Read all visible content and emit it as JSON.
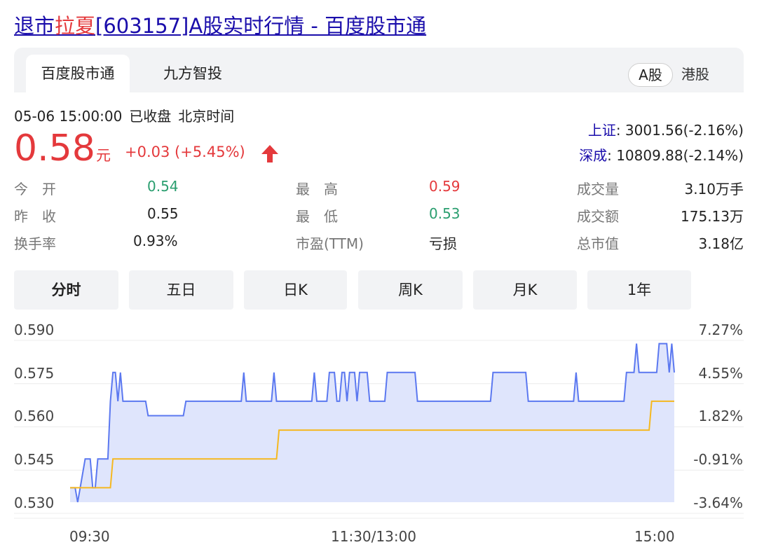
{
  "title": {
    "prefix": "退市",
    "highlight": "拉夏",
    "suffix": "[603157]A股实时行情 - 百度股市通"
  },
  "tabs": [
    "百度股市通",
    "九方智投"
  ],
  "market_toggle": {
    "a_share": "A股",
    "hk_share": "港股"
  },
  "status": {
    "datetime": "05-06 15:00:00",
    "state": "已收盘",
    "timezone": "北京时间"
  },
  "quote": {
    "price": "0.58",
    "unit": "元",
    "change": "+0.03 (+5.45%)",
    "direction": "up"
  },
  "indices": [
    {
      "name": "上证",
      "value": ": 3001.56(-2.16%)"
    },
    {
      "name": "深成",
      "value": ": 10809.88(-2.14%)"
    }
  ],
  "stats": {
    "open": {
      "label": "今　开",
      "value": "0.54"
    },
    "prev": {
      "label": "昨　收",
      "value": "0.55"
    },
    "turnover": {
      "label": "换手率",
      "value": "0.93%"
    },
    "high": {
      "label": "最　高",
      "value": "0.59"
    },
    "low": {
      "label": "最　低",
      "value": "0.53"
    },
    "pe": {
      "label": "市盈(TTM)",
      "value": "亏损"
    },
    "volume": {
      "label": "成交量",
      "value": "3.10万手"
    },
    "amount": {
      "label": "成交额",
      "value": "175.13万"
    },
    "mktcap": {
      "label": "总市值",
      "value": "3.18亿"
    }
  },
  "periods": [
    "分时",
    "五日",
    "日K",
    "周K",
    "月K",
    "1年"
  ],
  "colors": {
    "up": "#e4393c",
    "down": "#2a9e6f",
    "price_line": "#5b78f0",
    "avg_line": "#f5b820",
    "fill": "#dfe5fc"
  },
  "chart_data": {
    "type": "line",
    "y_left_ticks": [
      "0.590",
      "0.575",
      "0.560",
      "0.545",
      "0.530"
    ],
    "y_right_ticks": [
      "7.27%",
      "4.55%",
      "1.82%",
      "-0.91%",
      "-3.64%"
    ],
    "x_ticks": [
      "09:30",
      "11:30/13:00",
      "15:00"
    ],
    "ylim": [
      0.525,
      0.595
    ],
    "x_range": [
      0,
      240
    ],
    "grid": true,
    "series": [
      {
        "role": "price",
        "x": [
          0,
          2,
          3,
          4,
          6,
          8,
          9,
          10,
          11,
          15,
          16,
          17,
          18,
          19,
          20,
          21,
          22,
          23,
          24,
          28,
          29,
          30,
          31,
          32,
          33,
          34,
          44,
          45,
          46,
          54,
          55,
          56,
          68,
          69,
          70,
          71,
          72,
          80,
          81,
          82,
          83,
          96,
          97,
          98,
          99,
          102,
          103,
          104,
          105,
          106,
          107,
          108,
          109,
          110,
          111,
          112,
          113,
          114,
          115,
          116,
          117,
          118,
          119,
          125,
          126,
          127,
          128,
          135,
          136,
          137,
          138,
          140,
          141,
          142,
          143,
          144,
          165,
          166,
          167,
          168,
          169,
          174,
          175,
          176,
          177,
          178,
          180,
          181,
          182,
          183,
          200,
          201,
          202,
          203,
          220,
          221,
          222,
          223,
          224,
          225,
          226,
          233,
          234,
          235,
          236,
          237,
          238,
          239,
          240
        ],
        "values": [
          0.535,
          0.535,
          0.53,
          0.535,
          0.545,
          0.545,
          0.535,
          0.535,
          0.545,
          0.545,
          0.565,
          0.575,
          0.575,
          0.565,
          0.575,
          0.565,
          0.565,
          0.565,
          0.565,
          0.565,
          0.565,
          0.565,
          0.56,
          0.56,
          0.56,
          0.56,
          0.56,
          0.56,
          0.565,
          0.565,
          0.565,
          0.565,
          0.565,
          0.575,
          0.565,
          0.565,
          0.565,
          0.565,
          0.575,
          0.565,
          0.565,
          0.565,
          0.575,
          0.565,
          0.565,
          0.565,
          0.575,
          0.575,
          0.575,
          0.565,
          0.565,
          0.575,
          0.575,
          0.565,
          0.575,
          0.575,
          0.575,
          0.565,
          0.575,
          0.575,
          0.575,
          0.575,
          0.565,
          0.565,
          0.575,
          0.575,
          0.575,
          0.575,
          0.575,
          0.575,
          0.565,
          0.565,
          0.565,
          0.565,
          0.565,
          0.565,
          0.565,
          0.565,
          0.565,
          0.575,
          0.575,
          0.575,
          0.575,
          0.575,
          0.575,
          0.575,
          0.575,
          0.575,
          0.565,
          0.565,
          0.565,
          0.575,
          0.565,
          0.565,
          0.565,
          0.575,
          0.575,
          0.575,
          0.575,
          0.585,
          0.575,
          0.575,
          0.585,
          0.585,
          0.585,
          0.585,
          0.575,
          0.585,
          0.575
        ]
      },
      {
        "role": "average",
        "x": [
          0,
          16,
          17,
          18,
          19,
          82,
          83,
          84,
          230,
          231,
          232,
          233,
          234,
          240
        ],
        "values": [
          0.535,
          0.535,
          0.545,
          0.545,
          0.545,
          0.545,
          0.555,
          0.555,
          0.555,
          0.565,
          0.565,
          0.565,
          0.565,
          0.565
        ]
      }
    ]
  }
}
